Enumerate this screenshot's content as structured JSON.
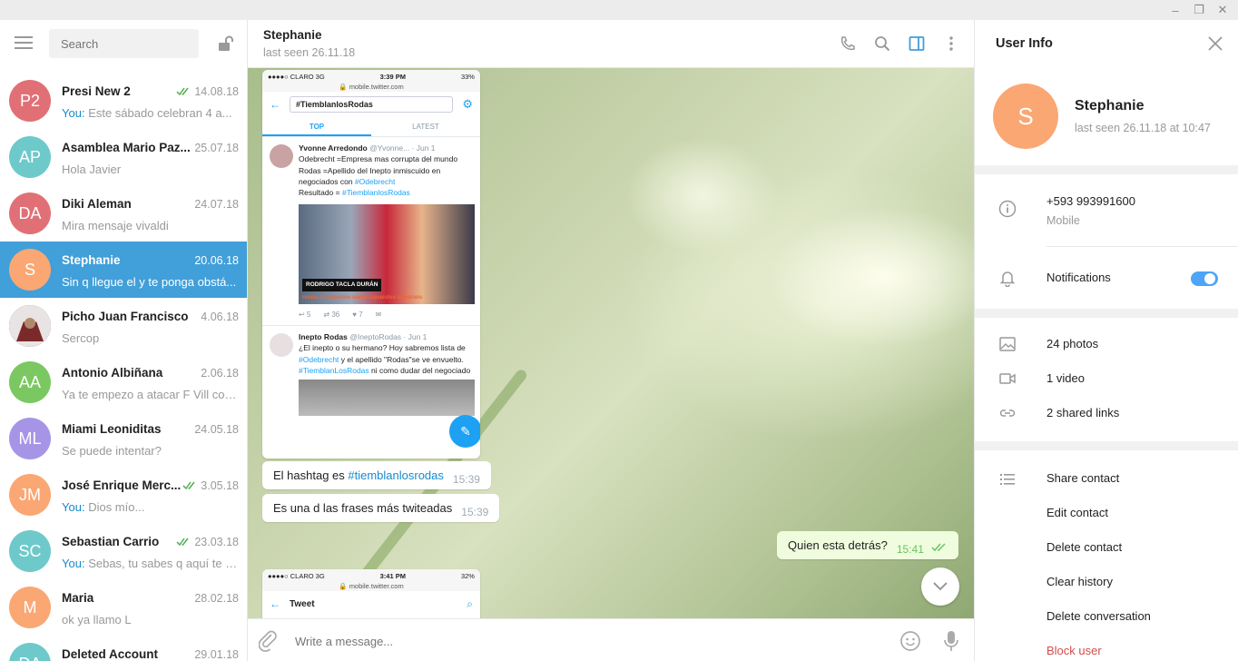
{
  "window": {
    "minimize_icon": "minimize-icon",
    "restore_icon": "restore-icon",
    "close_icon": "close-icon"
  },
  "sidebar": {
    "search_placeholder": "Search",
    "chats": [
      {
        "initials": "P2",
        "color": "#e17076",
        "name": "Presi New 2",
        "date": "14.08.18",
        "read": true,
        "you": "You:",
        "message": "Este sábado celebran 4 a..."
      },
      {
        "initials": "AP",
        "color": "#6ec9cb",
        "name": "Asamblea Mario Paz...",
        "date": "25.07.18",
        "read": false,
        "you": "",
        "message": "Hola Javier"
      },
      {
        "initials": "DA",
        "color": "#e17076",
        "name": "Diki Aleman",
        "date": "24.07.18",
        "read": false,
        "you": "",
        "message": "Mira mensaje vivaldi"
      },
      {
        "initials": "S",
        "color": "#faa774",
        "name": "Stephanie",
        "date": "20.06.18",
        "read": false,
        "you": "",
        "message": "Sin q llegue el y te ponga obstá..."
      },
      {
        "initials": "",
        "color": "#6d3030",
        "name": "Picho Juan Francisco",
        "date": "4.06.18",
        "read": false,
        "you": "",
        "message": "Sercop"
      },
      {
        "initials": "AA",
        "color": "#7bc862",
        "name": "Antonio Albiñana",
        "date": "2.06.18",
        "read": false,
        "you": "",
        "message": "Ya te empezo a atacar F Vill con..."
      },
      {
        "initials": "ML",
        "color": "#a695e7",
        "name": "Miami Leoniditas",
        "date": "24.05.18",
        "read": false,
        "you": "",
        "message": "Se puede intentar?"
      },
      {
        "initials": "JM",
        "color": "#faa774",
        "name": "José Enrique Merc...",
        "date": "3.05.18",
        "read": true,
        "you": "You:",
        "message": "Dios mío..."
      },
      {
        "initials": "SC",
        "color": "#6ec9cb",
        "name": "Sebastian Carrio",
        "date": "23.03.18",
        "read": true,
        "you": "You:",
        "message": "Sebas, tu sabes q aquí te q..."
      },
      {
        "initials": "M",
        "color": "#faa774",
        "name": "Maria",
        "date": "28.02.18",
        "read": false,
        "you": "",
        "message": "ok ya llamo L"
      },
      {
        "initials": "DA",
        "color": "#6ec9cb",
        "name": "Deleted Account",
        "date": "29.01.18",
        "read": false,
        "you": "",
        "message": ""
      }
    ]
  },
  "chat": {
    "peer_name": "Stephanie",
    "peer_status": "last seen 26.11.18",
    "screenshot1": {
      "carrier": "●●●●○ CLARO  3G",
      "time": "3:39 PM",
      "battery": "33%",
      "url": "🔒 mobile.twitter.com",
      "search": "#TiemblanlosRodas",
      "tab_top": "TOP",
      "tab_latest": "LATEST",
      "tweet1_name": "Yvonne Arredondo",
      "tweet1_handle": "@Yvonne... · Jun 1",
      "tweet1_text": "Odebrecht =Empresa mas corrupta del mundo Rodas =Apellido del Inepto inmiscuido en negociados con",
      "tweet1_link1": "#Odebrecht",
      "tweet1_result": "Resultado =",
      "tweet1_link2": "#TiemblanlosRodas",
      "img_caption": "RODRIGO TACLA DURÁN",
      "img_caption2": "revela información sobre supuestos sobornos",
      "tweet1_actions": [
        "5",
        "36",
        "7"
      ],
      "tweet2_name": "Inepto Rodas",
      "tweet2_handle": "@IneptoRodas · Jun 1",
      "tweet2_text_a": "¿El inepto o su hermano? Hoy sabremos lista de",
      "tweet2_link1": "#Odebrecht",
      "tweet2_text_b": "y el apellido \"Rodas\"se ve envuelto.",
      "tweet2_link2": "#TiemblanLosRodas",
      "tweet2_text_c": "ni como dudar del negociado"
    },
    "screenshot2": {
      "carrier": "●●●●○ CLARO  3G",
      "time": "3:41 PM",
      "battery": "32%",
      "url": "🔒 mobile.twitter.com",
      "title": "Tweet"
    },
    "messages": [
      {
        "text_a": "El hashtag es ",
        "hashtag": "#tiemblanlosrodas",
        "time": "15:39"
      },
      {
        "text": "Es una d las frases más twiteadas",
        "time": "15:39"
      },
      {
        "text": "Quien esta detrás?",
        "time": "15:41"
      }
    ],
    "input_placeholder": "Write a message..."
  },
  "info": {
    "title": "User Info",
    "name": "Stephanie",
    "initial": "S",
    "status": "last seen 26.11.18 at 10:47",
    "phone": "+593 993991600",
    "phone_label": "Mobile",
    "notifications": "Notifications",
    "notifications_on": true,
    "photos": "24 photos",
    "video": "1 video",
    "links": "2 shared links",
    "actions": [
      "Share contact",
      "Edit contact",
      "Delete contact",
      "Clear history",
      "Delete conversation",
      "Block user"
    ]
  },
  "colors": {
    "accent": "#419fd9",
    "link": "#168acd",
    "toggle": "#4ea4f6",
    "danger": "#d14e4e"
  }
}
